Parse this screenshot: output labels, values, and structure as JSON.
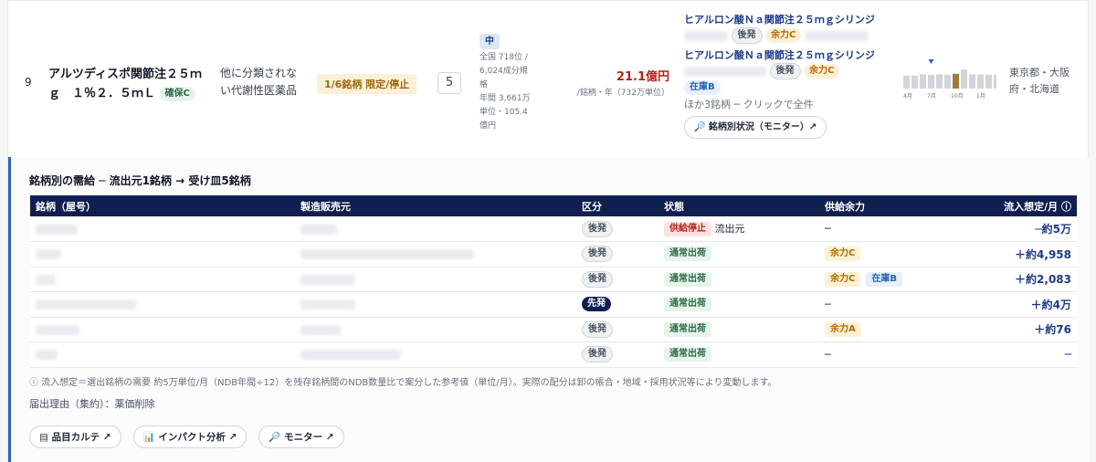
{
  "row": {
    "rank": "9",
    "product_name": "アルツディスポ関節注２５ｍｇ　１％２．５ｍＬ",
    "product_badge": "確保C",
    "category": "他に分類されない代謝性医薬品",
    "limit_chip": "1/6銘柄 限定/停止",
    "alt_count": "5",
    "scale_badge": "中",
    "scale_text": [
      "全国 718位 /",
      "6,024成分規",
      "格",
      "年間 3,661万",
      "単位・105.4",
      "億円"
    ],
    "amount_value": "21.1億円",
    "amount_unit": "/銘柄・年（732万単位）",
    "alternatives": [
      {
        "name": "ヒアルロン酸Ｎａ関節注２５ｍｇシリンジ",
        "badges": [
          "後発",
          "余力C"
        ]
      },
      {
        "name": "ヒアルロン酸Ｎａ関節注２５ｍｇシリンジ",
        "badges": [
          "後発",
          "余力C",
          "在庫B"
        ]
      }
    ],
    "more_text": "ほか3銘柄 ─ クリックで全件",
    "monitor_button": "🔎 銘柄別状況（モニター）↗",
    "spark": {
      "values": [
        0.55,
        0.55,
        0.6,
        0.58,
        0.6,
        0.58,
        0.62,
        0.8,
        0.6,
        0.6,
        0.58,
        0.58
      ],
      "highlight_index": 6,
      "marker_index": 3,
      "labels": [
        "4月",
        "7月",
        "10月",
        "1月"
      ]
    },
    "regions": "東京都・大阪府・北海道"
  },
  "detail": {
    "title": "銘柄別の需給 ─ 流出元1銘柄 → 受け皿5銘柄",
    "columns": [
      "銘柄（屋号）",
      "製造販売元",
      "区分",
      "状態",
      "供給余力",
      "流入想定/月 ⓘ"
    ],
    "rows": [
      {
        "kubun": "後発",
        "status": "供給停止",
        "status_extra": "流出元",
        "yoryoku": [
          "─"
        ],
        "inflow": "─約5万"
      },
      {
        "kubun": "後発",
        "status": "通常出荷",
        "status_extra": "",
        "yoryoku": [
          "余力C"
        ],
        "inflow": "＋約4,958"
      },
      {
        "kubun": "後発",
        "status": "通常出荷",
        "status_extra": "",
        "yoryoku": [
          "余力C",
          "在庫B"
        ],
        "inflow": "＋約2,083"
      },
      {
        "kubun": "先発",
        "status": "通常出荷",
        "status_extra": "",
        "yoryoku": [
          "─"
        ],
        "inflow": "＋約4万"
      },
      {
        "kubun": "後発",
        "status": "通常出荷",
        "status_extra": "",
        "yoryoku": [
          "余力A"
        ],
        "inflow": "＋約76"
      },
      {
        "kubun": "後発",
        "status": "通常出荷",
        "status_extra": "",
        "yoryoku": [
          "─"
        ],
        "inflow": "─"
      }
    ],
    "note": "ⓘ 流入想定＝選出銘柄の需要 約5万単位/月（NDB年間÷12）を残存銘柄間のNDB数量比で案分した参考値（単位/月）。実際の配分は卸の帳合・地域・採用状況等により変動します。",
    "reason": "届出理由（集約）：薬価削除",
    "links": [
      "▤ 品目カルテ ↗",
      "📊 インパクト分析 ↗",
      "🔎 モニター ↗"
    ]
  }
}
